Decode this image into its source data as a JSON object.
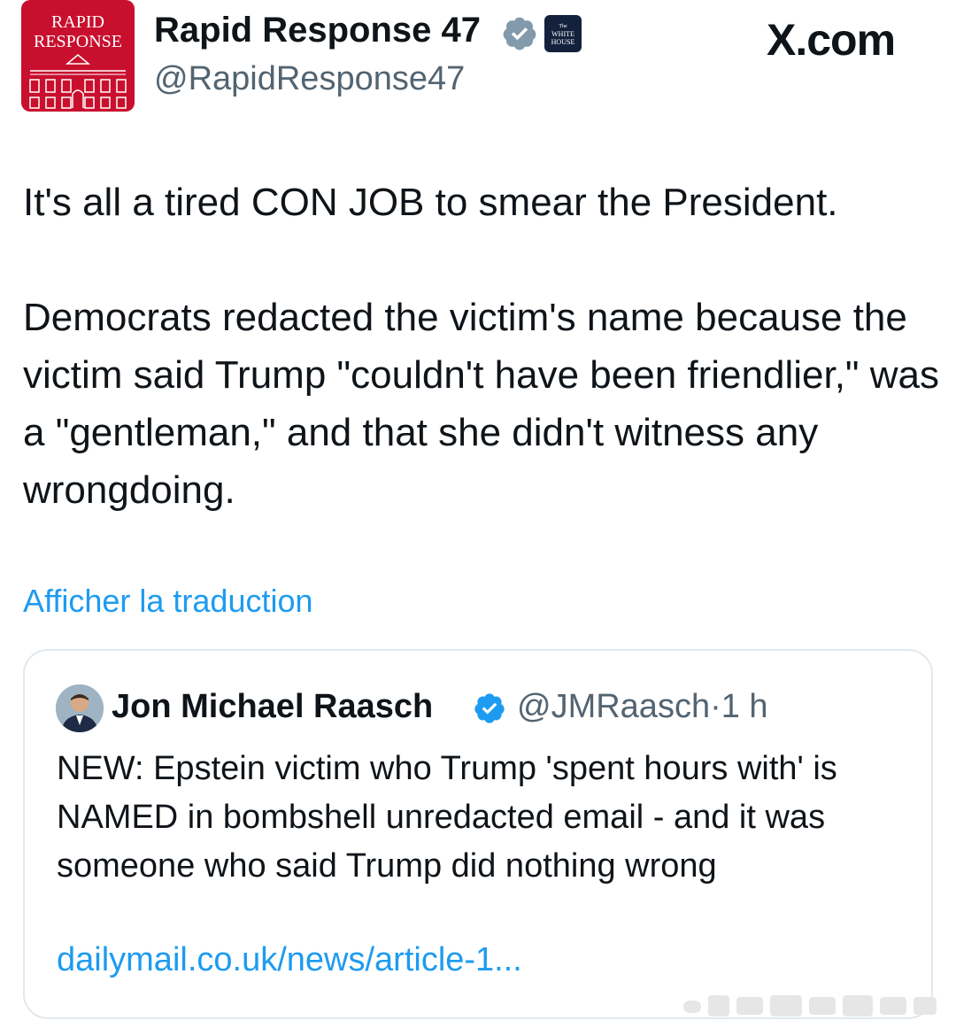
{
  "tweet": {
    "avatar": {
      "line1": "RAPID",
      "line2": "RESPONSE",
      "background_color": "#c8102e"
    },
    "display_name": "Rapid Response 47",
    "verified_badge": "gray-verified-icon",
    "affiliate_badge": {
      "line1": "The",
      "line2": "WHITE",
      "line3": "HOUSE"
    },
    "handle": "@RapidResponse47",
    "text": "It's all a tired CON JOB to smear the President.\n\nDemocrats redacted the victim's name because the victim said Trump \"couldn't have been friendlier,\" was a \"gentleman,\" and that she didn't witness any wrongdoing.",
    "translate_label": "Afficher la traduction"
  },
  "site_label": "X.com",
  "quoted_tweet": {
    "display_name": "Jon Michael Raasch",
    "verified_badge": "blue-verified-icon",
    "handle": "@JMRaasch",
    "separator": "·",
    "time": "1 h",
    "text": "NEW: Epstein victim who Trump 'spent hours with' is NAMED in bombshell unredacted email - and it was someone who said Trump did nothing wrong",
    "link": "dailymail.co.uk/news/article-1..."
  },
  "colors": {
    "text_primary": "#0f1419",
    "text_secondary": "#536471",
    "link_blue": "#1d9bf0",
    "card_border": "#e1e8ed",
    "brand_red": "#c8102e"
  }
}
